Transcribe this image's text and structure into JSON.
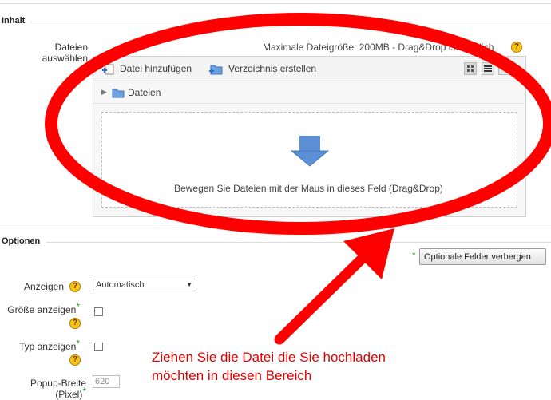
{
  "sections": {
    "inhalt": "Inhalt",
    "optionen": "Optionen"
  },
  "filepicker": {
    "label_line1": "Dateien",
    "label_line2": "auswählen",
    "max_size_text": "Maximale Dateigröße: 200MB - Drag&Drop ist möglich",
    "add_file": "Datei hinzufügen",
    "create_folder": "Verzeichnis erstellen",
    "breadcrumb_folder": "Dateien",
    "drop_hint": "Bewegen Sie Dateien mit der Maus in dieses Feld (Drag&Drop)"
  },
  "options": {
    "toggle_optional": "Optionale Felder verbergen",
    "required_marker": "*",
    "help_glyph": "?",
    "display_label": "Anzeigen",
    "display_value": "Automatisch",
    "show_size_label": "Größe anzeigen",
    "show_type_label": "Typ anzeigen",
    "popup_width_label_line1": "Popup-Breite",
    "popup_width_label_line2": "(Pixel)",
    "popup_width_value": "620"
  },
  "annotation": {
    "line1": "Ziehen Sie die Datei die Sie hochladen",
    "line2": "möchten in diesen Bereich",
    "color": "#e00000"
  },
  "colors": {
    "annotation_red": "#ff0000",
    "required_green": "#2a9d2a",
    "help_yellow": "#f5c518",
    "drop_arrow_blue": "#5b8fd6"
  }
}
